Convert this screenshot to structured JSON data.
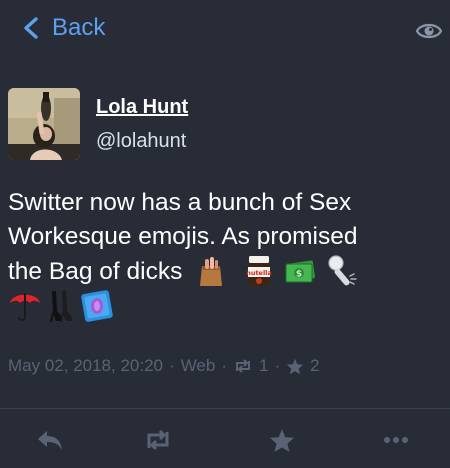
{
  "nav": {
    "back_label": "Back"
  },
  "account": {
    "display_name": "Lola Hunt",
    "handle": "@lolahunt"
  },
  "status": {
    "line1": "Switter now has a bunch of Sex",
    "line2": "Workesque emojis. As promised",
    "line3": "the Bag of dicks",
    "emojis": [
      "bag-of-dicks-emoji",
      "nutella-emoji",
      "money-emoji",
      "vibrator-emoji",
      "red-umbrella-emoji",
      "heels-emoji",
      "condom-emoji"
    ],
    "nutella_text": "nutella"
  },
  "meta": {
    "date": "May 02, 2018, 20:20",
    "application": "Web",
    "reblogs": "1",
    "favourites": "2"
  },
  "colors": {
    "background": "#282c37",
    "accent": "#5ea0ee",
    "muted": "#5a6275"
  }
}
